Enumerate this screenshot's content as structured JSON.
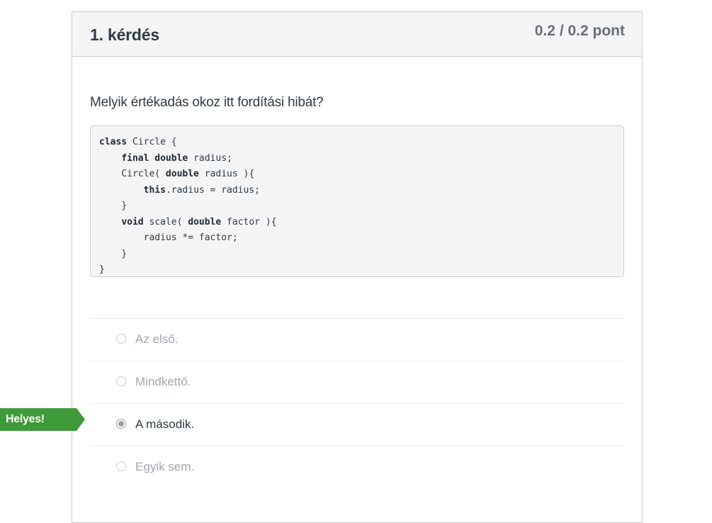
{
  "question": {
    "title": "1. kérdés",
    "score": "0.2 / 0.2 pont",
    "text": "Melyik értékadás okoz itt fordítási hibát?"
  },
  "code": [
    [
      {
        "k": true,
        "t": "class"
      },
      {
        "k": false,
        "t": " Circle {"
      }
    ],
    [
      {
        "k": false,
        "t": "    "
      },
      {
        "k": true,
        "t": "final"
      },
      {
        "k": false,
        "t": " "
      },
      {
        "k": true,
        "t": "double"
      },
      {
        "k": false,
        "t": " radius;"
      }
    ],
    [
      {
        "k": false,
        "t": "    Circle( "
      },
      {
        "k": true,
        "t": "double"
      },
      {
        "k": false,
        "t": " radius ){"
      }
    ],
    [
      {
        "k": false,
        "t": "        "
      },
      {
        "k": true,
        "t": "this"
      },
      {
        "k": false,
        "t": ".radius = radius;"
      }
    ],
    [
      {
        "k": false,
        "t": "    }"
      }
    ],
    [
      {
        "k": false,
        "t": "    "
      },
      {
        "k": true,
        "t": "void"
      },
      {
        "k": false,
        "t": " scale( "
      },
      {
        "k": true,
        "t": "double"
      },
      {
        "k": false,
        "t": " factor ){"
      }
    ],
    [
      {
        "k": false,
        "t": "        radius *= factor;"
      }
    ],
    [
      {
        "k": false,
        "t": "    }"
      }
    ],
    [
      {
        "k": false,
        "t": "}"
      }
    ]
  ],
  "answers": [
    {
      "label": "Az első.",
      "selected": false
    },
    {
      "label": "Mindkettő.",
      "selected": false
    },
    {
      "label": "A második.",
      "selected": true
    },
    {
      "label": "Egyik sem.",
      "selected": false
    }
  ],
  "feedback": {
    "correct_label": "Helyes!",
    "color": "#3f9a3a"
  }
}
